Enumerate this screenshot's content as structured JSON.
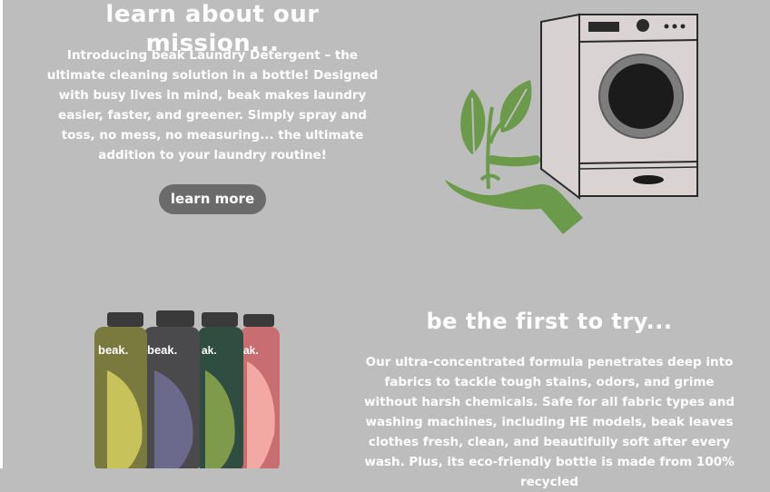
{
  "mission": {
    "title": "learn about our mission...",
    "body": "Introducing beak Laundry Detergent – the ultimate cleaning solution in a bottle! Designed with busy lives in mind, beak makes laundry easier, faster, and greener. Simply spray and toss, no mess, no measuring... the ultimate addition to your laundry routine!",
    "button_label": "learn more"
  },
  "try": {
    "title": "be the first to try...",
    "body": "Our ultra-concentrated formula penetrates deep into fabrics to tackle tough stains, odors, and grime without harsh chemicals. Safe for all fabric types and washing machines, including HE models, beak leaves clothes fresh, clean, and beautifully soft after every wash. Plus, its eco-friendly bottle is made from 100% recycled"
  },
  "bottles": {
    "labels": [
      "beak.",
      "beak.",
      "ak.",
      "ak."
    ]
  },
  "colors": {
    "background": "#bdbdbd",
    "button": "#6b6b6b",
    "leaf_green": "#6a9a4a",
    "bottle_olive": "#7a7a3e",
    "bottle_slate": "#4a4a4c",
    "bottle_forest": "#2f4d40",
    "bottle_rose": "#c86e70"
  }
}
